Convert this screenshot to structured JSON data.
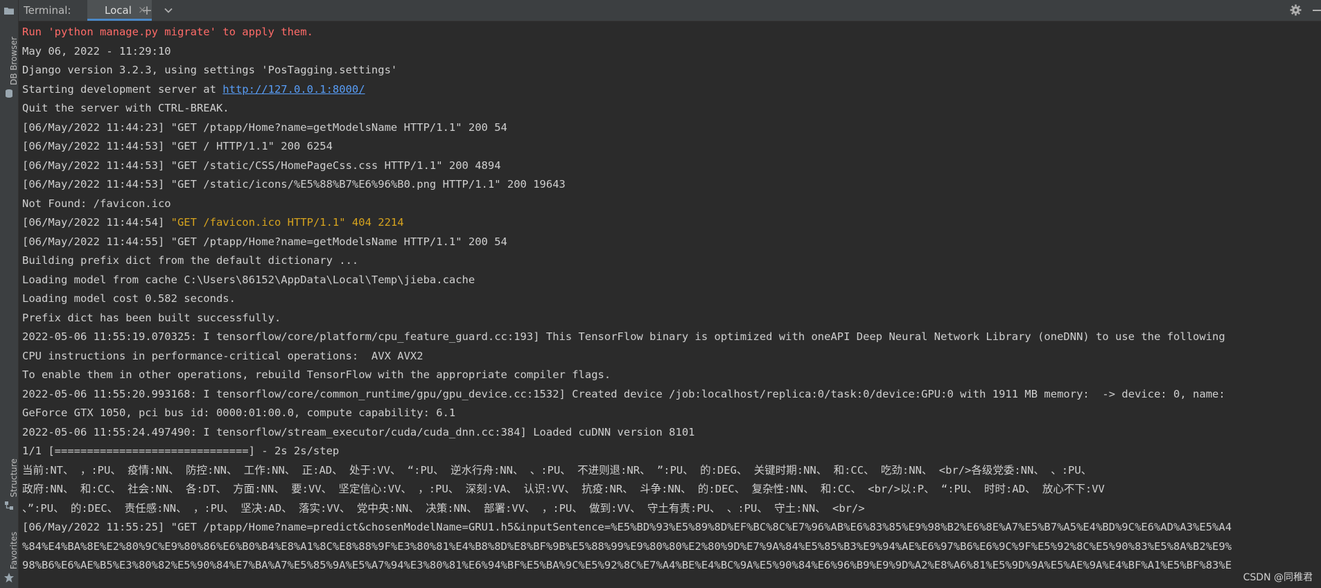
{
  "sidebar": {
    "top_tool": "DB Browser",
    "bottom_tools": [
      "Structure",
      "Favorites"
    ]
  },
  "header": {
    "title": "Terminal:",
    "tab_label": "Local",
    "tab_close": "×",
    "new_tab": "+",
    "dropdown": "⌄"
  },
  "terminal": {
    "lines": [
      {
        "text": "Run 'python manage.py migrate' to apply them.",
        "style": "red"
      },
      {
        "text": "May 06, 2022 - 11:29:10"
      },
      {
        "text": "Django version 3.2.3, using settings 'PosTagging.settings'"
      },
      {
        "prefix": "Starting development server at ",
        "link": "http://127.0.0.1:8000/"
      },
      {
        "text": "Quit the server with CTRL-BREAK."
      },
      {
        "text": "[06/May/2022 11:44:23] \"GET /ptapp/Home?name=getModelsName HTTP/1.1\" 200 54"
      },
      {
        "text": "[06/May/2022 11:44:53] \"GET / HTTP/1.1\" 200 6254"
      },
      {
        "text": "[06/May/2022 11:44:53] \"GET /static/CSS/HomePageCss.css HTTP/1.1\" 200 4894"
      },
      {
        "text": "[06/May/2022 11:44:53] \"GET /static/icons/%E5%88%B7%E6%96%B0.png HTTP/1.1\" 200 19643"
      },
      {
        "text": "Not Found: /favicon.ico"
      },
      {
        "prefix": "[06/May/2022 11:44:54] ",
        "highlight": "\"GET /favicon.ico HTTP/1.1\" 404 2214"
      },
      {
        "text": "[06/May/2022 11:44:55] \"GET /ptapp/Home?name=getModelsName HTTP/1.1\" 200 54"
      },
      {
        "text": "Building prefix dict from the default dictionary ..."
      },
      {
        "text": "Loading model from cache C:\\Users\\86152\\AppData\\Local\\Temp\\jieba.cache"
      },
      {
        "text": "Loading model cost 0.582 seconds."
      },
      {
        "text": "Prefix dict has been built successfully."
      },
      {
        "text": "2022-05-06 11:55:19.070325: I tensorflow/core/platform/cpu_feature_guard.cc:193] This TensorFlow binary is optimized with oneAPI Deep Neural Network Library (oneDNN) to use the following"
      },
      {
        "text": "CPU instructions in performance-critical operations:  AVX AVX2"
      },
      {
        "text": "To enable them in other operations, rebuild TensorFlow with the appropriate compiler flags."
      },
      {
        "text": "2022-05-06 11:55:20.993168: I tensorflow/core/common_runtime/gpu/gpu_device.cc:1532] Created device /job:localhost/replica:0/task:0/device:GPU:0 with 1911 MB memory:  -> device: 0, name:"
      },
      {
        "text": "GeForce GTX 1050, pci bus id: 0000:01:00.0, compute capability: 6.1"
      },
      {
        "text": "2022-05-06 11:55:24.497490: I tensorflow/stream_executor/cuda/cuda_dnn.cc:384] Loaded cuDNN version 8101"
      },
      {
        "text": "1/1 [==============================] - 2s 2s/step"
      },
      {
        "text": "当前:NT、 ，:PU、 疫情:NN、 防控:NN、 工作:NN、 正:AD、 处于:VV、 “:PU、 逆水行舟:NN、 、:PU、 不进则退:NR、 ”:PU、 的:DEG、 关键时期:NN、 和:CC、 吃劲:NN、 <br/>各级党委:NN、 、:PU、"
      },
      {
        "text": "政府:NN、 和:CC、 社会:NN、 各:DT、 方面:NN、 要:VV、 坚定信心:VV、 ，:PU、 深刻:VA、 认识:VV、 抗疫:NR、 斗争:NN、 的:DEC、 复杂性:NN、 和:CC、 <br/>以:P、 “:PU、 时时:AD、 放心不下:VV"
      },
      {
        "text": "、”:PU、 的:DEC、 责任感:NN、 ，:PU、 坚决:AD、 落实:VV、 党中央:NN、 决策:NN、 部署:VV、 ，:PU、 做到:VV、 守土有责:PU、 、:PU、 守土:NN、 <br/>"
      },
      {
        "text": "[06/May/2022 11:55:25] \"GET /ptapp/Home?name=predict&chosenModelName=GRU1.h5&inputSentence=%E5%BD%93%E5%89%8D%EF%BC%8C%E7%96%AB%E6%83%85%E9%98%B2%E6%8E%A7%E5%B7%A5%E4%BD%9C%E6%AD%A3%E5%A4"
      },
      {
        "text": "%84%E4%BA%8E%E2%80%9C%E9%80%86%E6%B0%B4%E8%A1%8C%E8%88%9F%E3%80%81%E4%B8%8D%E8%BF%9B%E5%88%99%E9%80%80%E2%80%9D%E7%9A%84%E5%85%B3%E9%94%AE%E6%97%B6%E6%9C%9F%E5%92%8C%E5%90%83%E5%8A%B2%E9%"
      },
      {
        "text": "98%B6%E6%AE%B5%E3%80%82%E5%90%84%E7%BA%A7%E5%85%9A%E5%A7%94%E3%80%81%E6%94%BF%E5%BA%9C%E5%92%8C%E7%A4%BE%E4%BC%9A%E5%90%84%E6%96%B9%E9%9D%A2%E8%A6%81%E5%9D%9A%E5%AE%9A%E4%BF%A1%E5%BF%83%E"
      }
    ]
  },
  "watermark": "CSDN @同稚君"
}
